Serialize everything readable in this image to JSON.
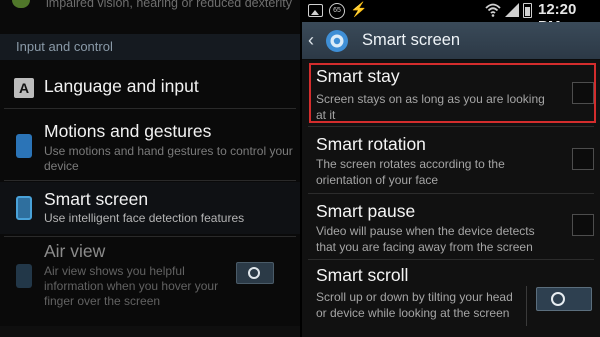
{
  "left": {
    "top_fragment": "impaired vision, hearing or reduced dexterity",
    "section_header": "Input and control",
    "items": [
      {
        "title": "Language and input",
        "subtitle": ""
      },
      {
        "title": "Motions and gestures",
        "subtitle": "Use motions and hand gestures to control your device"
      },
      {
        "title": "Smart screen",
        "subtitle": "Use intelligent face detection features"
      },
      {
        "title": "Air view",
        "subtitle": "Air view shows you helpful information when you hover your finger over the screen"
      }
    ],
    "language_icon_letter": "A"
  },
  "right": {
    "status_bar": {
      "time": "12:20 PM",
      "badge_text": "65",
      "icons": [
        "image-icon",
        "badge-icon",
        "bolt-icon",
        "wifi-icon",
        "signal-icon",
        "battery-icon"
      ]
    },
    "action_bar": {
      "title": "Smart screen",
      "back_icon": "chevron-left-icon",
      "app_icon": "gear-icon"
    },
    "items": [
      {
        "title": "Smart stay",
        "desc": "Screen stays on as long as you are looking at it",
        "checked": false
      },
      {
        "title": "Smart rotation",
        "desc": "The screen rotates according to the orientation of your face",
        "checked": false
      },
      {
        "title": "Smart pause",
        "desc": "Video will pause when the device detects that you are facing away from the screen",
        "checked": false
      },
      {
        "title": "Smart scroll",
        "desc": "Scroll up or down by tilting your head or device while looking at the screen",
        "toggle": "off"
      }
    ],
    "highlight_color": "#d42d2d"
  }
}
